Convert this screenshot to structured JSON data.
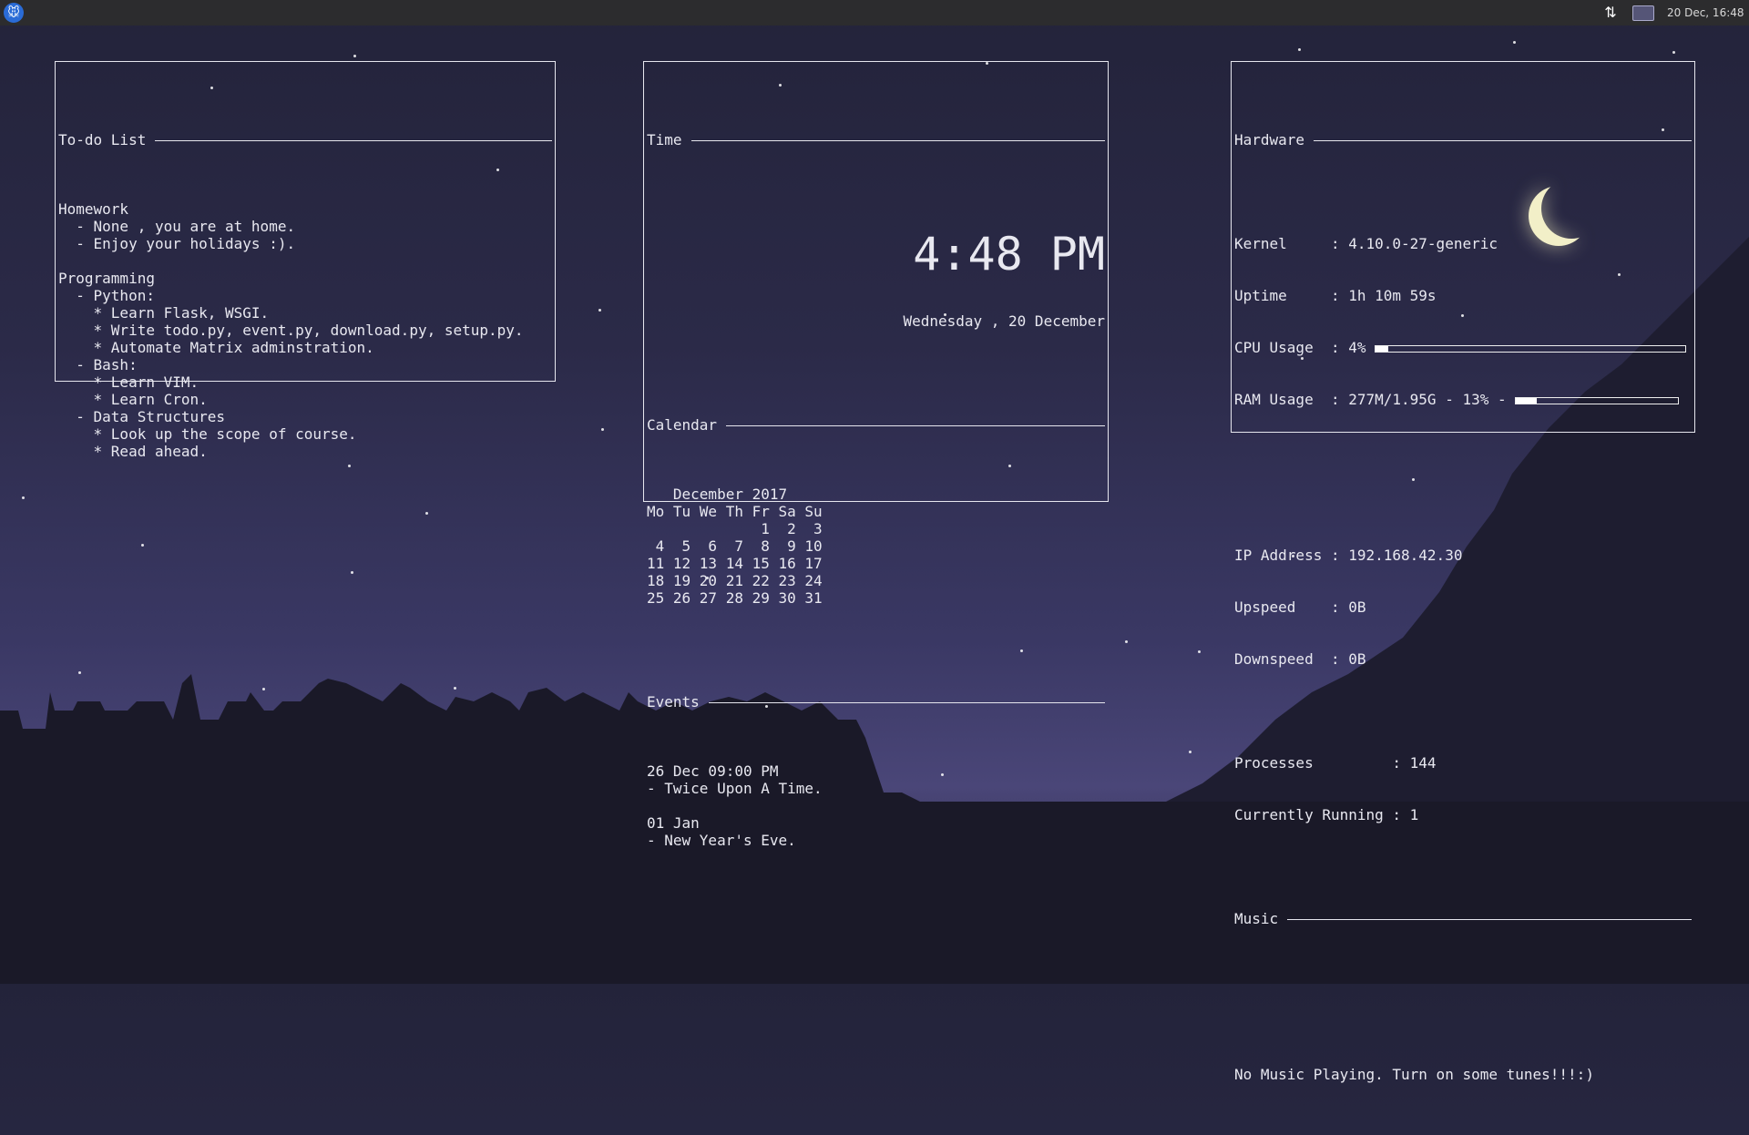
{
  "panel": {
    "clock": "20 Dec, 16:48",
    "icons": [
      "whisker-menu-icon",
      "network-icon",
      "display-icon"
    ]
  },
  "todo": {
    "title": "To-do List",
    "lines": [
      "",
      "Homework",
      "  - None , you are at home.",
      "  - Enjoy your holidays :).",
      "",
      "Programming",
      "  - Python:",
      "    * Learn Flask, WSGI.",
      "    * Write todo.py, event.py, download.py, setup.py.",
      "    * Automate Matrix adminstration.",
      "  - Bash:",
      "    * Learn VIM.",
      "    * Learn Cron.",
      "  - Data Structures",
      "    * Look up the scope of course.",
      "    * Read ahead."
    ]
  },
  "time": {
    "title": "Time",
    "clock": "4:48 PM",
    "date": "Wednesday , 20 December",
    "calendar_title": "Calendar",
    "calendar_lines": [
      "",
      "   December 2017",
      "Mo Tu We Th Fr Sa Su",
      "             1  2  3",
      " 4  5  6  7  8  9 10",
      "11 12 13 14 15 16 17",
      "18 19 20 21 22 23 24",
      "25 26 27 28 29 30 31"
    ],
    "events_title": "Events",
    "events_lines": [
      "",
      "26 Dec 09:00 PM",
      "- Twice Upon A Time.",
      "",
      "01 Jan",
      "- New Year's Eve."
    ]
  },
  "hardware": {
    "title": "Hardware",
    "kernel": "Kernel     : 4.10.0-27-generic",
    "uptime": "Uptime     : 1h 10m 59s",
    "cpu": "CPU Usage  : 4%",
    "cpu_percent": 4,
    "ram": "RAM Usage  : 277M/1.95G - 13% -",
    "ram_percent": 13,
    "ip": "IP Address : 192.168.42.30",
    "upspeed": "Upspeed    : 0B",
    "downspeed": "Downspeed  : 0B",
    "processes": "Processes         : 144",
    "running": "Currently Running : 1",
    "music_title": "Music",
    "music_status": "No Music Playing. Turn on some tunes!!!:)"
  }
}
